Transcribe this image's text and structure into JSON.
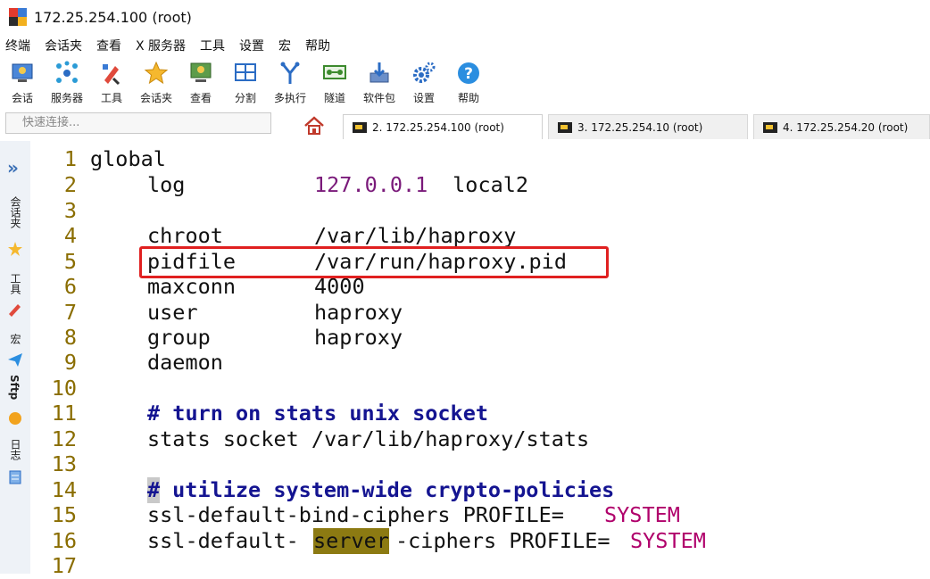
{
  "window": {
    "title": "172.25.254.100 (root)"
  },
  "menu": [
    "终端",
    "会话夹",
    "查看",
    "X 服务器",
    "工具",
    "设置",
    "宏",
    "帮助"
  ],
  "toolbar": [
    {
      "label": "会话",
      "icon": "session-icon"
    },
    {
      "label": "服务器",
      "icon": "server-icon"
    },
    {
      "label": "工具",
      "icon": "tools-icon"
    },
    {
      "label": "会话夹",
      "icon": "star-icon"
    },
    {
      "label": "查看",
      "icon": "view-icon"
    },
    {
      "label": "分割",
      "icon": "split-icon"
    },
    {
      "label": "多执行",
      "icon": "multiexec-icon"
    },
    {
      "label": "隧道",
      "icon": "tunnel-icon"
    },
    {
      "label": "软件包",
      "icon": "package-icon"
    },
    {
      "label": "设置",
      "icon": "gear-icon"
    },
    {
      "label": "帮助",
      "icon": "help-icon"
    }
  ],
  "quick_connect": {
    "placeholder": "快速连接..."
  },
  "tabs": [
    {
      "label": "2. 172.25.254.100 (root)",
      "active": true
    },
    {
      "label": "3. 172.25.254.10 (root)",
      "active": false
    },
    {
      "label": "4. 172.25.254.20 (root)",
      "active": false
    }
  ],
  "sidebar": [
    "会话夹",
    "工具",
    "宏",
    "Sftp",
    "日志"
  ],
  "editor": {
    "lines": [
      {
        "n": "1",
        "text": "global"
      },
      {
        "n": "2",
        "key": "log",
        "value": "127.0.0.1",
        "rest": " local2"
      },
      {
        "n": "3",
        "text": ""
      },
      {
        "n": "4",
        "key": "chroot",
        "rest": "/var/lib/haproxy"
      },
      {
        "n": "5",
        "key": "pidfile",
        "rest": "/var/run/haproxy.pid"
      },
      {
        "n": "6",
        "key": "maxconn",
        "rest": "4000"
      },
      {
        "n": "7",
        "key": "user",
        "rest": "haproxy"
      },
      {
        "n": "8",
        "key": "group",
        "rest": "haproxy"
      },
      {
        "n": "9",
        "key": "daemon",
        "rest": ""
      },
      {
        "n": "10",
        "text": ""
      },
      {
        "n": "11",
        "comment": "# turn on stats unix socket"
      },
      {
        "n": "12",
        "text": "stats socket /var/lib/haproxy/stats"
      },
      {
        "n": "13",
        "text": ""
      },
      {
        "n": "14",
        "comment_hash": "#",
        "comment": " utilize system-wide crypto-policies"
      },
      {
        "n": "15",
        "text": "ssl-default-bind-ciphers PROFILE=",
        "const": "SYSTEM"
      },
      {
        "n": "16",
        "pre": "ssl-default-",
        "hl": "server",
        "post": "-ciphers PROFILE=",
        "const": "SYSTEM"
      },
      {
        "n": "17",
        "text": ""
      }
    ]
  }
}
